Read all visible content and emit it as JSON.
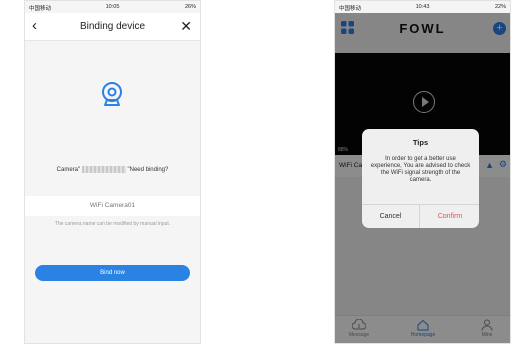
{
  "left": {
    "status": {
      "carrier": "中国移动",
      "time": "10:05",
      "battery": "26%"
    },
    "nav": {
      "title": "Binding device",
      "back_icon": "chevron-left-icon",
      "close_icon": "close-icon"
    },
    "icon": "camera-icon",
    "question_prefix": "Camera\"",
    "question_suffix": "\"Need binding?",
    "camera_name": "WiFi Camera01",
    "hint": "The camera name can be modified by manual input.",
    "bind_button": "Bind now",
    "accent": "#2a82e4"
  },
  "right": {
    "status": {
      "carrier": "中国移动",
      "time": "10:43",
      "battery": "22%"
    },
    "brand": "FOWL",
    "battery_overlay": "88%",
    "device_label": "WiFi Ca",
    "dialog": {
      "title": "Tips",
      "message": "In order to get a better use experience, You are advised to check the WiFi signal strength of the camera.",
      "cancel": "Cancel",
      "confirm": "Confirm",
      "confirm_color": "#e85050"
    },
    "tabs": [
      {
        "label": "Message",
        "icon": "cloud-message-icon"
      },
      {
        "label": "Homepage",
        "icon": "home-icon",
        "active": true
      },
      {
        "label": "Mine",
        "icon": "user-icon"
      }
    ]
  }
}
